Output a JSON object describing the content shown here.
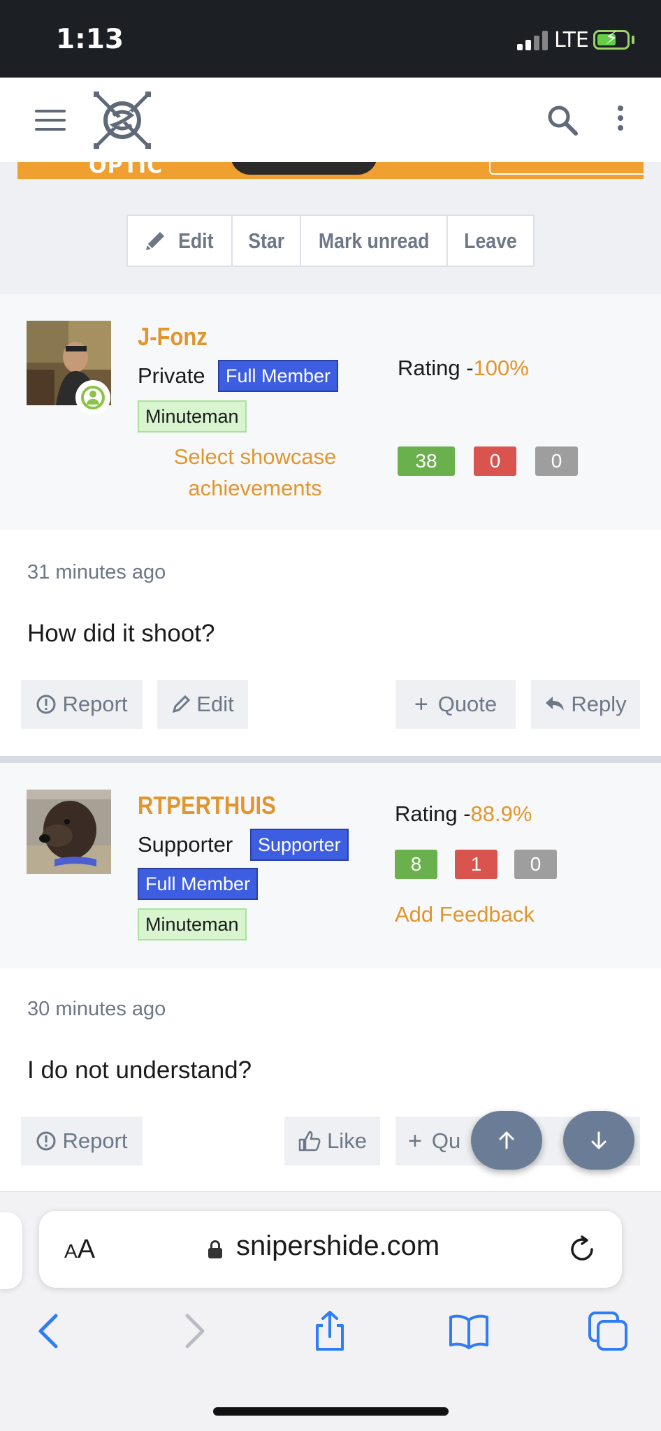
{
  "status_bar": {
    "time": "1:13",
    "network": "LTE"
  },
  "browser": {
    "url": "snipershide.com",
    "text_size_label_small": "A",
    "text_size_label_large": "A"
  },
  "ad_banner": {
    "text": "OPTIC"
  },
  "thread_actions": [
    {
      "label": "Edit",
      "icon": "pencil-icon"
    },
    {
      "label": "Star"
    },
    {
      "label": "Mark unread"
    },
    {
      "label": "Leave"
    }
  ],
  "posts": [
    {
      "username": "J-Fonz",
      "user_title": "Private",
      "banners": [
        "Full Member"
      ],
      "group_tag": "Minuteman",
      "showcase_link": "Select showcase achievements",
      "rating_label": "Rating -",
      "rating_value": "100%",
      "feedback": {
        "positive": "38",
        "negative": "0",
        "neutral": "0"
      },
      "timestamp": "31 minutes ago",
      "message": "How did it shoot?",
      "actions": {
        "report": "Report",
        "edit": "Edit",
        "quote": "Quote",
        "reply": "Reply"
      }
    },
    {
      "username": "RTPERTHUIS",
      "user_title": "Supporter",
      "banners": [
        "Supporter",
        "Full Member"
      ],
      "group_tag": "Minuteman",
      "feedback_link": "Add Feedback",
      "rating_label": "Rating -",
      "rating_value": "88.9%",
      "feedback": {
        "positive": "8",
        "negative": "1",
        "neutral": "0"
      },
      "timestamp": "30 minutes ago",
      "message": "I do not understand?",
      "actions": {
        "report": "Report",
        "like": "Like",
        "quote": "Qu"
      }
    }
  ],
  "colors": {
    "accent_orange": "#e0962e",
    "banner_blue": "#3d5ee0",
    "tag_green": "#d8f5cf",
    "feedback_green": "#6ab04c",
    "feedback_red": "#d9534f",
    "feedback_gray": "#9e9e9e"
  }
}
